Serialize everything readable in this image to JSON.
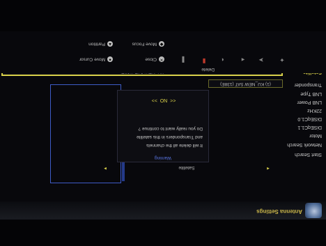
{
  "header": {
    "title": "Antenna Settings"
  },
  "settings": {
    "rows": [
      "Satellite",
      "Transponder",
      "LNB Type",
      "LNB Power",
      "22KHz",
      "DiSEqC1.0",
      "DiSEqC1.1",
      "Motor",
      "Network Search",
      "Start Search"
    ],
    "satellite_value": "KU_NEW SAT (138E)",
    "transponder_value": "KU_NEW SAT (138E)",
    "transponder_index": "(1)",
    "search_satellite": "Satellite"
  },
  "dialog": {
    "title": "Warning",
    "lines": [
      "It will delete all the channels",
      "and Transponders in this satellite",
      "Do you really want to continue ?"
    ],
    "no_label": "NO"
  },
  "legend": {
    "delete_label": "Delete",
    "close_label": "Close",
    "move_cursor_label": "Move Cursor",
    "move_focus_label": "Move Focus",
    "partition_label": "Partition"
  },
  "colors": {
    "accent_yellow": "#d9d04a",
    "accent_blue": "#3e5cc7"
  }
}
